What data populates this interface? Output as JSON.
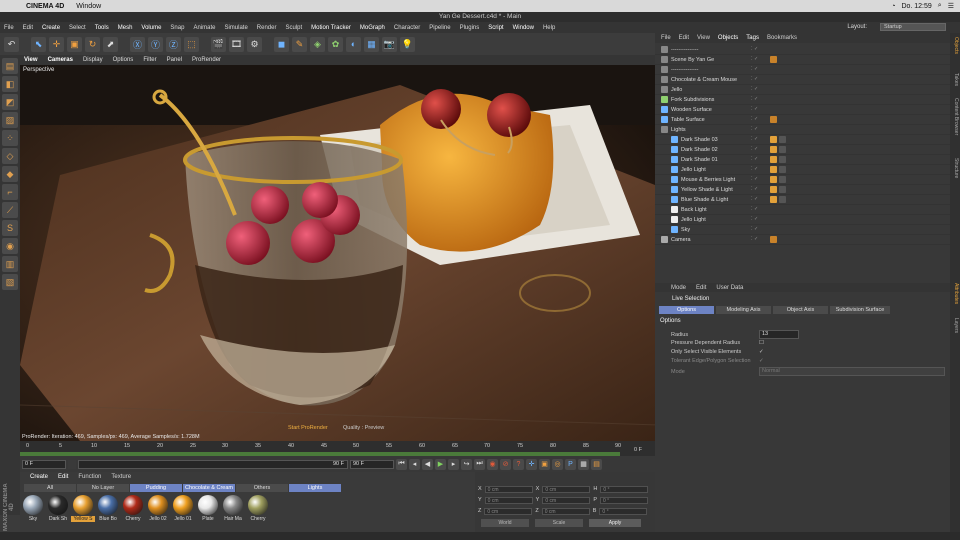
{
  "mac": {
    "app": "CINEMA 4D",
    "menu": "Window",
    "clock": "Do. 12:59"
  },
  "window_title": "Yan Ge Dessert.c4d * - Main",
  "menu": [
    "File",
    "Edit",
    "Create",
    "Select",
    "Tools",
    "Mesh",
    "Volume",
    "Snap",
    "Animate",
    "Simulate",
    "Render",
    "Sculpt",
    "Motion Tracker",
    "MoGraph",
    "Character",
    "Pipeline",
    "Plugins",
    "Script",
    "Window",
    "Help"
  ],
  "layout": {
    "label": "Layout:",
    "value": "Startup"
  },
  "viewport": {
    "menu": [
      "View",
      "Cameras",
      "Display",
      "Options",
      "Filter",
      "Panel",
      "ProRender"
    ],
    "label": "Perspective",
    "status": "ProRender: Iteration: 469, Samples/px: 469, Average Samples/s: 1.728M",
    "start": "Start ProRender",
    "quality": "Quality : Preview"
  },
  "timeline": {
    "ticks": [
      "0",
      "5",
      "10",
      "15",
      "20",
      "25",
      "30",
      "35",
      "40",
      "45",
      "50",
      "55",
      "60",
      "65",
      "70",
      "75",
      "80",
      "85",
      "90"
    ],
    "end": "0 F"
  },
  "transport": {
    "current": "0 F",
    "start": "0 F",
    "end": "90 F",
    "max": "90 F"
  },
  "materials": {
    "menu": [
      "Create",
      "Edit",
      "Function",
      "Texture"
    ],
    "tabs": [
      "All",
      "No Layer",
      "Pudding",
      "Chocolate & Cream",
      "Others",
      "Lights"
    ],
    "items": [
      {
        "name": "Sky",
        "color": "#9aa8b8"
      },
      {
        "name": "Dark Sh",
        "color": "#2a2a2a"
      },
      {
        "name": "Yellow S",
        "color": "#e8a030"
      },
      {
        "name": "Blue Bo",
        "color": "#4a6fa8"
      },
      {
        "name": "Cherry",
        "color": "#b02a18"
      },
      {
        "name": "Jello 02",
        "color": "#e09020"
      },
      {
        "name": "Jello 01",
        "color": "#f0a020"
      },
      {
        "name": "Plate",
        "color": "#e8e8e8"
      },
      {
        "name": "Hair Ma",
        "color": "#888888"
      },
      {
        "name": "Cherry",
        "color": "#a0a060"
      }
    ]
  },
  "coords": {
    "rows": [
      {
        "a": "X",
        "av": "0 cm",
        "b": "X",
        "bv": "0 cm",
        "c": "H",
        "cv": "0 °"
      },
      {
        "a": "Y",
        "av": "0 cm",
        "b": "Y",
        "bv": "0 cm",
        "c": "P",
        "cv": "0 °"
      },
      {
        "a": "Z",
        "av": "0 cm",
        "b": "Z",
        "bv": "0 cm",
        "c": "B",
        "cv": "0 °"
      }
    ],
    "world": "World",
    "scale": "Scale",
    "apply": "Apply"
  },
  "objects": {
    "menu": [
      "File",
      "Edit",
      "View",
      "Objects",
      "Tags",
      "Bookmarks"
    ],
    "rows": [
      {
        "name": "---------------",
        "indent": 0,
        "icon": "#888"
      },
      {
        "name": "Scene By Yan Ge",
        "indent": 0,
        "icon": "#888"
      },
      {
        "name": "---------------",
        "indent": 0,
        "icon": "#888"
      },
      {
        "name": "Chocolate & Cream Mouse",
        "indent": 0,
        "icon": "#888"
      },
      {
        "name": "Jello",
        "indent": 0,
        "icon": "#888"
      },
      {
        "name": "Fork Subdivisions",
        "indent": 0,
        "icon": "#8fd06f"
      },
      {
        "name": "Wooden Surface",
        "indent": 0,
        "icon": "#6fb4ff"
      },
      {
        "name": "Table Surface",
        "indent": 0,
        "icon": "#6fb4ff"
      },
      {
        "name": "Lights",
        "indent": 0,
        "icon": "#888"
      },
      {
        "name": "Dark Shade 03",
        "indent": 1,
        "icon": "#6fb4ff"
      },
      {
        "name": "Dark Shade 02",
        "indent": 1,
        "icon": "#6fb4ff"
      },
      {
        "name": "Dark Shade 01",
        "indent": 1,
        "icon": "#6fb4ff"
      },
      {
        "name": "Jello Light",
        "indent": 1,
        "icon": "#6fb4ff"
      },
      {
        "name": "Mouse & Berries Light",
        "indent": 1,
        "icon": "#6fb4ff"
      },
      {
        "name": "Yellow Shade & Light",
        "indent": 1,
        "icon": "#6fb4ff"
      },
      {
        "name": "Blue Shade & Light",
        "indent": 1,
        "icon": "#6fb4ff"
      },
      {
        "name": "Back Light",
        "indent": 1,
        "icon": "#eee"
      },
      {
        "name": "Jello Light",
        "indent": 1,
        "icon": "#eee"
      },
      {
        "name": "Sky",
        "indent": 1,
        "icon": "#6fb4ff"
      },
      {
        "name": "Camera",
        "indent": 0,
        "icon": "#aaa"
      }
    ]
  },
  "attributes": {
    "menu": [
      "Mode",
      "Edit",
      "User Data"
    ],
    "title": "Live Selection",
    "tabs": [
      "Options",
      "Modeling Axis",
      "Object Axis",
      "Subdivision Surface"
    ],
    "section": "Options",
    "radius_label": "Radius",
    "radius_value": "13",
    "pressure": "Pressure Dependent Radius",
    "only_visible": "Only Select Visible Elements",
    "tolerant": "Tolerant Edge/Polygon Selection",
    "mode_label": "Mode",
    "mode_value": "Normal"
  },
  "right_tabs": [
    "Objects",
    "Takes",
    "Content Browser",
    "Structure",
    "Attributes",
    "Layers"
  ],
  "brand": "MAXON CINEMA 4D"
}
